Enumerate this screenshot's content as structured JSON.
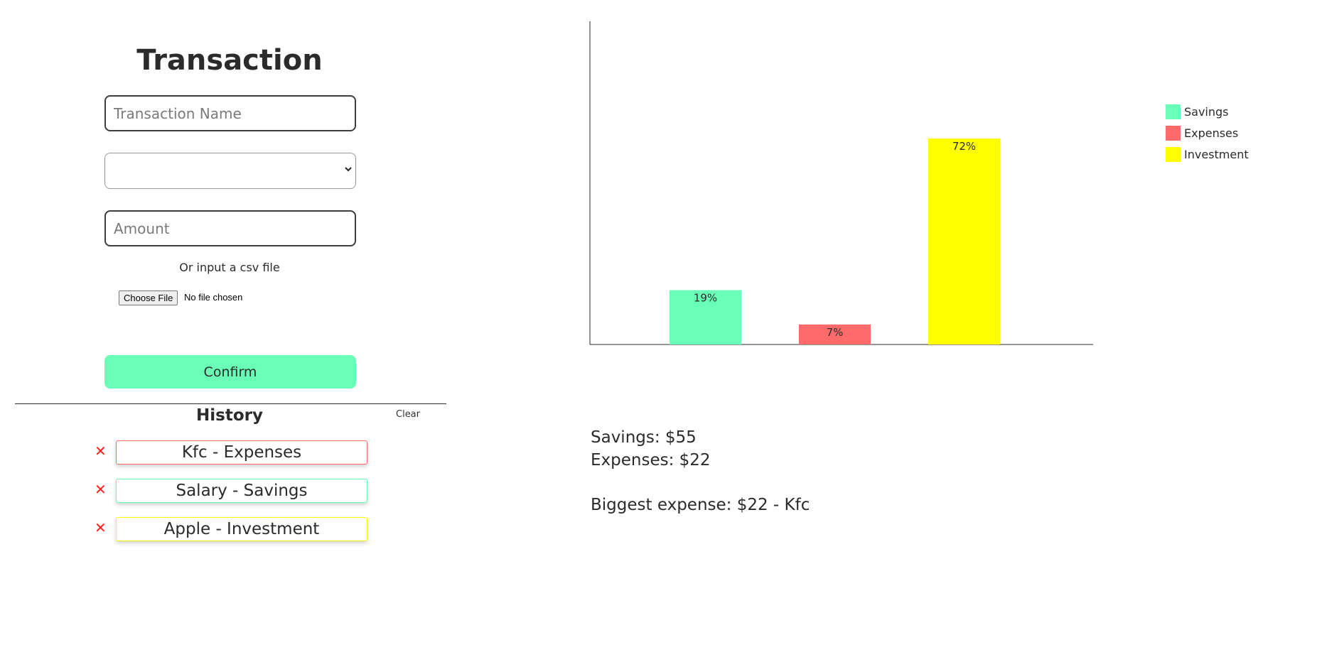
{
  "form": {
    "title": "Transaction",
    "name_placeholder": "Transaction Name",
    "category_value": "",
    "amount_placeholder": "Amount",
    "csv_label": "Or input a csv file",
    "file_button": "Choose File",
    "file_status": "No file chosen",
    "confirm_label": "Confirm"
  },
  "history": {
    "title": "History",
    "clear_label": "Clear",
    "delete_glyph": "✕",
    "items": [
      {
        "label": "Kfc - Expenses",
        "color": "#ff6b6b"
      },
      {
        "label": "Salary - Savings",
        "color": "#69ffb6"
      },
      {
        "label": "Apple - Investment",
        "color": "#ffff00"
      }
    ]
  },
  "chart_data": {
    "type": "bar",
    "categories": [
      "Savings",
      "Expenses",
      "Investment"
    ],
    "values": [
      19,
      7,
      72
    ],
    "labels": [
      "19%",
      "7%",
      "72%"
    ],
    "colors": [
      "#69ffb6",
      "#ff6b6b",
      "#ffff00"
    ],
    "ylim": [
      0,
      100
    ],
    "legend": "right",
    "grid": false
  },
  "summary": {
    "savings": "Savings: $55",
    "expenses": "Expenses: $22",
    "biggest": "Biggest expense: $22 - Kfc"
  }
}
